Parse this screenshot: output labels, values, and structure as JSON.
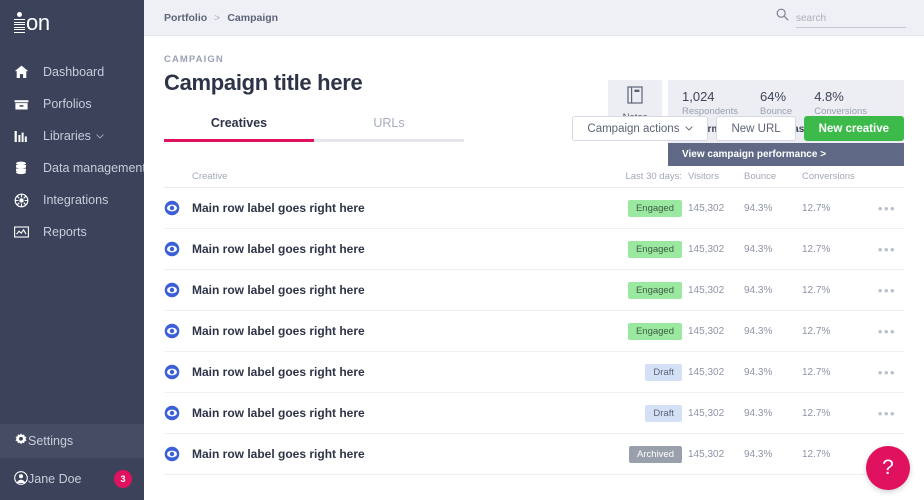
{
  "brand": {
    "logo_text": "on",
    "accent_pink": "#e0115f",
    "accent_green": "#3dbb4a",
    "sidebar_bg": "#3b4259"
  },
  "sidebar": {
    "items": [
      {
        "label": "Dashboard",
        "icon": "home-icon",
        "caret": false
      },
      {
        "label": "Porfolios",
        "icon": "folder-icon",
        "caret": false
      },
      {
        "label": "Libraries",
        "icon": "bar-chart-icon",
        "caret": true
      },
      {
        "label": "Data management",
        "icon": "database-icon",
        "caret": true
      },
      {
        "label": "Integrations",
        "icon": "integrations-icon",
        "caret": false
      },
      {
        "label": "Reports",
        "icon": "report-chart-icon",
        "caret": false
      }
    ],
    "settings": {
      "label": "Settings",
      "icon": "gear-icon"
    },
    "user": {
      "label": "Jane Doe",
      "icon": "avatar-icon",
      "notification_count": "3"
    }
  },
  "topbar": {
    "breadcrumb": {
      "parent": "Portfolio",
      "separator": ">",
      "current": "Campaign"
    },
    "search": {
      "placeholder": "search",
      "value": "",
      "icon": "search-icon"
    }
  },
  "header": {
    "eyebrow": "CAMPAIGN",
    "title": "Campaign title here"
  },
  "notes": {
    "label": "Notes",
    "icon": "notebook-icon"
  },
  "stats": {
    "items": [
      {
        "value": "1,024",
        "label": "Respondents"
      },
      {
        "value": "64%",
        "label": "Bounce"
      },
      {
        "value": "4.8%",
        "label": "Conversions"
      }
    ],
    "snapshot_label": "Performace snapshot (last 30 days)",
    "performance_link": "View campaign performance >"
  },
  "tabs": [
    {
      "label": "Creatives",
      "active": true
    },
    {
      "label": "URLs",
      "active": false
    }
  ],
  "actions": {
    "campaign_actions": "Campaign actions",
    "campaign_actions_caret": "chevron-down-icon",
    "new_url": "New URL",
    "new_creative": "New creative"
  },
  "table": {
    "headers": {
      "creative": "Creative",
      "last_30_days": "Last 30 days:",
      "visitors": "Visitors",
      "bounce": "Bounce",
      "conversions": "Conversions"
    },
    "menu_glyph": "•••",
    "rows": [
      {
        "label": "Main row label goes right here",
        "status": "Engaged",
        "status_kind": "engaged",
        "visitors": "145,302",
        "bounce": "94.3%",
        "conversions": "12.7%",
        "icon": "creative-eye-icon"
      },
      {
        "label": "Main row label goes right here",
        "status": "Engaged",
        "status_kind": "engaged",
        "visitors": "145,302",
        "bounce": "94.3%",
        "conversions": "12.7%",
        "icon": "creative-eye-icon"
      },
      {
        "label": "Main row label goes right here",
        "status": "Engaged",
        "status_kind": "engaged",
        "visitors": "145,302",
        "bounce": "94.3%",
        "conversions": "12.7%",
        "icon": "creative-eye-icon"
      },
      {
        "label": "Main row label goes right here",
        "status": "Engaged",
        "status_kind": "engaged",
        "visitors": "145,302",
        "bounce": "94.3%",
        "conversions": "12.7%",
        "icon": "creative-eye-icon"
      },
      {
        "label": "Main row label goes right here",
        "status": "Draft",
        "status_kind": "draft",
        "visitors": "145,302",
        "bounce": "94.3%",
        "conversions": "12.7%",
        "icon": "creative-eye-icon"
      },
      {
        "label": "Main row label goes right here",
        "status": "Draft",
        "status_kind": "draft",
        "visitors": "145,302",
        "bounce": "94.3%",
        "conversions": "12.7%",
        "icon": "creative-eye-icon"
      },
      {
        "label": "Main row label goes right here",
        "status": "Archived",
        "status_kind": "archived",
        "visitors": "145,302",
        "bounce": "94.3%",
        "conversions": "12.7%",
        "icon": "creative-eye-icon"
      }
    ]
  },
  "help": {
    "glyph": "?",
    "name": "help-button"
  }
}
